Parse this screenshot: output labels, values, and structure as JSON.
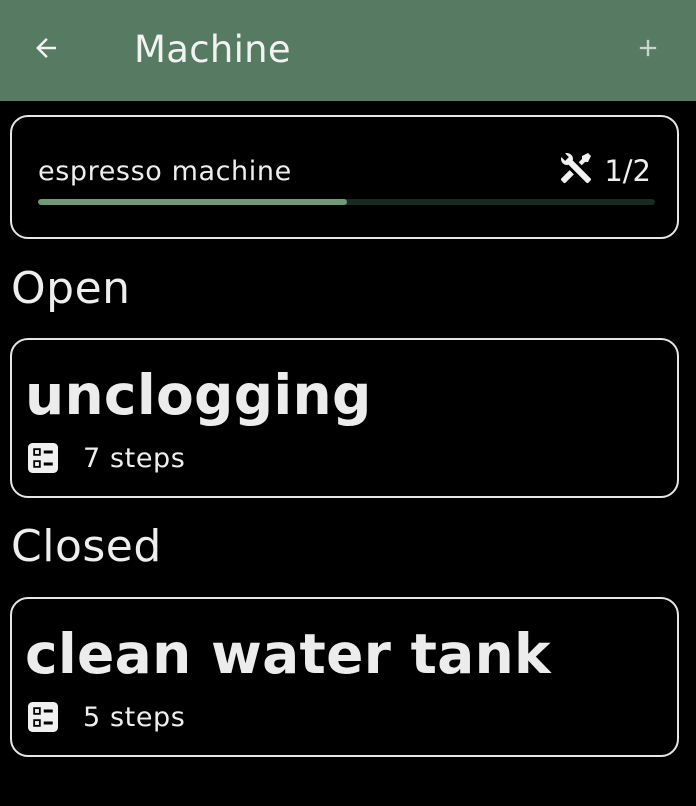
{
  "appbar": {
    "title": "Machine",
    "back_icon": "arrow-left-icon",
    "add_icon": "plus-icon",
    "background_color": "#577a62"
  },
  "machine": {
    "name": "espresso machine",
    "progress_label": "1/2",
    "progress_fraction": 0.5,
    "progress_icon": "tools-icon"
  },
  "sections": {
    "open_heading": "Open",
    "closed_heading": "Closed"
  },
  "tasks": [
    {
      "title": "unclogging",
      "steps_label": "7 steps",
      "icon": "list-icon",
      "section": "Open"
    },
    {
      "title": "clean water tank",
      "steps_label": "5 steps",
      "icon": "list-icon",
      "section": "Closed"
    }
  ]
}
